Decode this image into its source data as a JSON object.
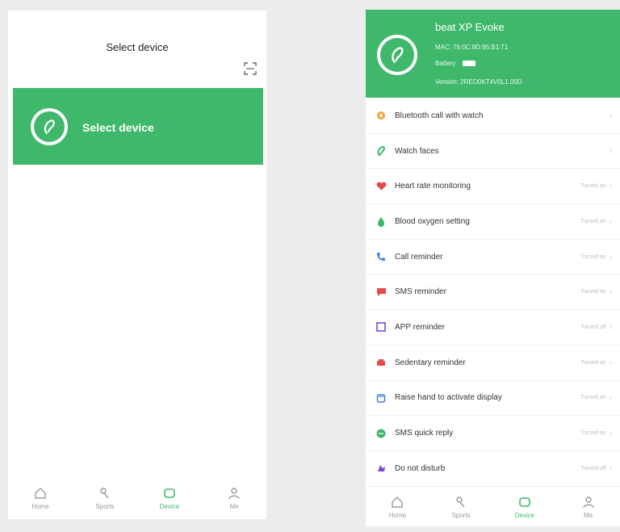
{
  "left_screen": {
    "title": "Select device",
    "banner_label": "Select device"
  },
  "right_screen": {
    "device_name": "beat XP Evoke",
    "mac_line": "MAC: 76:0C:8D:95:B1:71",
    "battery_label": "Battery",
    "version_line": "Version: 2REO0KT4V0L1.00D",
    "settings": [
      {
        "label": "Bluetooth call with watch",
        "status": "",
        "icon": "bluetooth-call-icon",
        "color": "#f3a33b"
      },
      {
        "label": "Watch faces",
        "status": "",
        "icon": "watch-faces-icon",
        "color": "#3fb86b"
      },
      {
        "label": "Heart rate monitoring",
        "status": "Turned on",
        "icon": "heart-icon",
        "color": "#e84a4a"
      },
      {
        "label": "Blood oxygen setting",
        "status": "Turned on",
        "icon": "blood-oxygen-icon",
        "color": "#3fb86b"
      },
      {
        "label": "Call reminder",
        "status": "Turned on",
        "icon": "phone-icon",
        "color": "#3f7fe0"
      },
      {
        "label": "SMS reminder",
        "status": "Turned on",
        "icon": "sms-icon",
        "color": "#e84a4a"
      },
      {
        "label": "APP reminder",
        "status": "Turned off",
        "icon": "app-icon",
        "color": "#7a4bd3"
      },
      {
        "label": "Sedentary reminder",
        "status": "Turned on",
        "icon": "sedentary-icon",
        "color": "#e84a4a"
      },
      {
        "label": "Raise hand to activate display",
        "status": "Turned on",
        "icon": "raise-hand-icon",
        "color": "#3f7fe0"
      },
      {
        "label": "SMS quick reply",
        "status": "Turned on",
        "icon": "quick-reply-icon",
        "color": "#3fb86b"
      },
      {
        "label": "Do not disturb",
        "status": "Turned off",
        "icon": "do-not-disturb-icon",
        "color": "#7a4bd3"
      }
    ]
  },
  "tabs": [
    {
      "label": "Home",
      "icon": "home-icon"
    },
    {
      "label": "Sports",
      "icon": "sports-icon"
    },
    {
      "label": "Device",
      "icon": "device-icon"
    },
    {
      "label": "Me",
      "icon": "me-icon"
    }
  ],
  "colors": {
    "accent": "#3fb86b",
    "inactive": "#9a9a9a"
  }
}
